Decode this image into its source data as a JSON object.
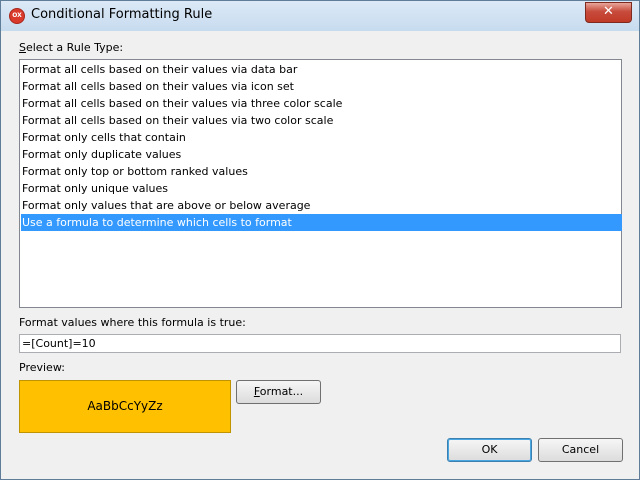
{
  "window": {
    "title": "Conditional Formatting Rule",
    "app_icon": "app-logo-icon",
    "app_icon_text": "OX",
    "close_glyph": "✕"
  },
  "rule_type": {
    "label": "Select a Rule Type:",
    "label_accesskey": "S",
    "label_rest": "elect a Rule Type:",
    "items": [
      {
        "label": "Format all cells based on their values via data bar",
        "selected": false
      },
      {
        "label": "Format all cells based on their values via icon set",
        "selected": false
      },
      {
        "label": "Format all cells based on their values via three color scale",
        "selected": false
      },
      {
        "label": "Format all cells based on their values via two color scale",
        "selected": false
      },
      {
        "label": "Format only cells that contain",
        "selected": false
      },
      {
        "label": "Format only duplicate values",
        "selected": false
      },
      {
        "label": "Format only top or bottom ranked values",
        "selected": false
      },
      {
        "label": "Format only unique values",
        "selected": false
      },
      {
        "label": "Format only values that are above or below average",
        "selected": false
      },
      {
        "label": "Use a formula to determine which cells to format",
        "selected": true
      }
    ]
  },
  "formula": {
    "label": "Format values where this formula is true:",
    "value": "=[Count]=10"
  },
  "preview": {
    "label": "Preview:",
    "sample_text": "AaBbCcYyZz",
    "fill_color": "#ffc000"
  },
  "buttons": {
    "format_label": "Format...",
    "format_accesskey": "F",
    "format_rest": "ormat...",
    "ok_label": "OK",
    "cancel_label": "Cancel"
  }
}
